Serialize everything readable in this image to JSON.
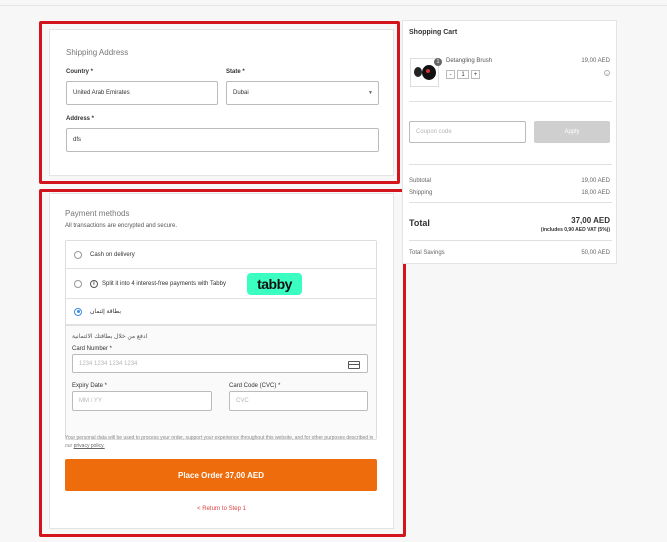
{
  "shipping": {
    "title": "Shipping Address",
    "country_label": "Country *",
    "country_value": "United Arab Emirates",
    "state_label": "State *",
    "state_value": "Dubai",
    "address_label": "Address *",
    "address_value": "dfs"
  },
  "payment": {
    "title": "Payment methods",
    "subtitle": "All transactions are encrypted and secure.",
    "options": [
      {
        "label": "Cash on delivery",
        "selected": false
      },
      {
        "label": "Split it into 4 interest-free payments with Tabby",
        "selected": false,
        "badge": "tabby",
        "badge_color": "#3bffc0"
      },
      {
        "label": "بطاقة إئتمان",
        "selected": true
      }
    ],
    "card": {
      "intro": "ادفع من خلال بطاقتك الائتمانية",
      "number_label": "Card Number *",
      "number_placeholder": "1234 1234 1234 1234",
      "expiry_label": "Expiry Date *",
      "expiry_placeholder": "MM / YY",
      "cvc_label": "Card Code (CVC) *",
      "cvc_placeholder": "CVC"
    },
    "privacy_text": "Your personal data will be used to process your order, support your experience throughout this website, and for other purposes described in our",
    "privacy_link": "privacy policy.",
    "place_order": "Place Order  37,00 AED",
    "back_link": "< Return to Step 1",
    "accent_color": "#ee6c0b"
  },
  "cart": {
    "title": "Shopping Cart",
    "item": {
      "name": "Detangling Brush",
      "price": "19,00 AED",
      "quantity": "1",
      "badge": "1",
      "minus": "-",
      "plus": "+",
      "remove": "×"
    },
    "coupon_placeholder": "Coupon code",
    "apply_label": "Apply",
    "subtotal_label": "Subtotal",
    "subtotal_value": "19,00 AED",
    "shipping_label": "Shipping",
    "shipping_value": "18,00 AED",
    "total_label": "Total",
    "total_value": "37,00 AED",
    "vat_note": "(includes 0,90 AED VAT (5%))",
    "savings_label": "Total Savings",
    "savings_value": "50,00 AED"
  },
  "highlight_color": "#d4141c"
}
